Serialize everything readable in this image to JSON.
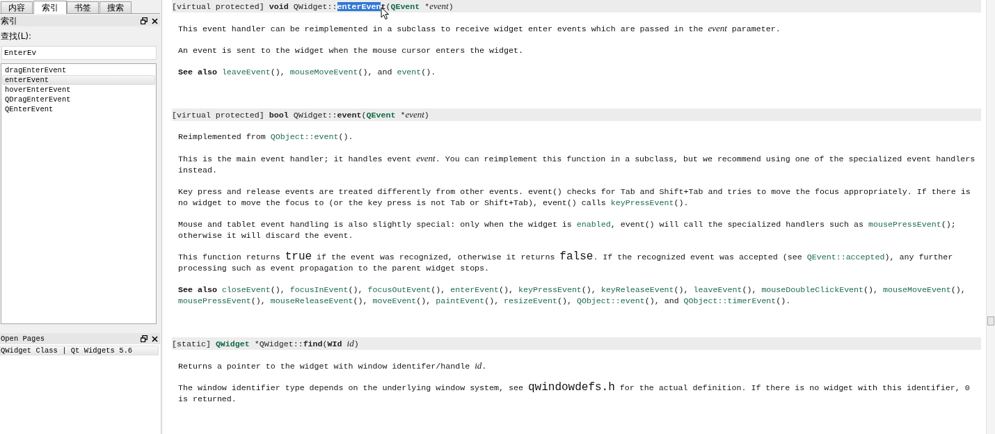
{
  "sidebar": {
    "tabs": [
      {
        "label": "内容",
        "selected": false
      },
      {
        "label": "索引",
        "selected": true
      },
      {
        "label": "书签",
        "selected": false
      },
      {
        "label": "搜索",
        "selected": false
      }
    ],
    "index_panel": {
      "title": "索引",
      "search_label": "查找(L):",
      "search_value": "EnterEv",
      "results": [
        {
          "label": "dragEnterEvent",
          "selected": false
        },
        {
          "label": "enterEvent",
          "selected": true
        },
        {
          "label": "hoverEnterEvent",
          "selected": false
        },
        {
          "label": "QDragEnterEvent",
          "selected": false
        },
        {
          "label": "QEnterEvent",
          "selected": false
        }
      ]
    },
    "open_pages": {
      "title": "Open Pages",
      "pages": [
        {
          "label": "QWidget Class | Qt Widgets 5.6",
          "selected": true
        }
      ]
    }
  },
  "document": {
    "sections": [
      {
        "signature": [
          {
            "kind": "plain",
            "text": "[virtual protected] "
          },
          {
            "kind": "bold",
            "text": "void"
          },
          {
            "kind": "plain",
            "text": " QWidget::"
          },
          {
            "kind": "selected",
            "text": "enterEven"
          },
          {
            "kind": "bold",
            "text": "t"
          },
          {
            "kind": "plain",
            "text": "("
          },
          {
            "kind": "type",
            "text": "QEvent"
          },
          {
            "kind": "plain",
            "text": " *"
          },
          {
            "kind": "italic",
            "text": "event"
          },
          {
            "kind": "plain",
            "text": ")"
          }
        ],
        "paragraphs": [
          [
            {
              "kind": "plain",
              "text": "This event handler can be reimplemented in a subclass to receive widget enter events which are passed in the "
            },
            {
              "kind": "italic",
              "text": "event"
            },
            {
              "kind": "plain",
              "text": " parameter."
            }
          ],
          [
            {
              "kind": "plain",
              "text": "An event is sent to the widget when the mouse cursor enters the widget."
            }
          ],
          [
            {
              "kind": "bold",
              "text": "See also "
            },
            {
              "kind": "link",
              "text": "leaveEvent"
            },
            {
              "kind": "plain",
              "text": "(), "
            },
            {
              "kind": "link",
              "text": "mouseMoveEvent"
            },
            {
              "kind": "plain",
              "text": "(), and "
            },
            {
              "kind": "link",
              "text": "event"
            },
            {
              "kind": "plain",
              "text": "()."
            }
          ]
        ]
      },
      {
        "signature": [
          {
            "kind": "plain",
            "text": "[virtual protected] "
          },
          {
            "kind": "bold",
            "text": "bool"
          },
          {
            "kind": "plain",
            "text": " QWidget::"
          },
          {
            "kind": "bold",
            "text": "event"
          },
          {
            "kind": "plain",
            "text": "("
          },
          {
            "kind": "type",
            "text": "QEvent"
          },
          {
            "kind": "plain",
            "text": " *"
          },
          {
            "kind": "italic",
            "text": "event"
          },
          {
            "kind": "plain",
            "text": ")"
          }
        ],
        "paragraphs": [
          [
            {
              "kind": "plain",
              "text": "Reimplemented from "
            },
            {
              "kind": "link",
              "text": "QObject::event"
            },
            {
              "kind": "plain",
              "text": "()."
            }
          ],
          [
            {
              "kind": "plain",
              "text": "This is the main event handler; it handles event "
            },
            {
              "kind": "italic",
              "text": "event"
            },
            {
              "kind": "plain",
              "text": ". You can reimplement this function in a subclass, but we recommend using one of the specialized event handlers instead."
            }
          ],
          [
            {
              "kind": "plain",
              "text": "Key press and release events are treated differently from other events. event() checks for Tab and Shift+Tab and tries to move the focus appropriately. If there is no widget to move the focus to (or the key press is not Tab or Shift+Tab), event() calls "
            },
            {
              "kind": "link",
              "text": "keyPressEvent"
            },
            {
              "kind": "plain",
              "text": "()."
            }
          ],
          [
            {
              "kind": "plain",
              "text": "Mouse and tablet event handling is also slightly special: only when the widget is "
            },
            {
              "kind": "link",
              "text": "enabled"
            },
            {
              "kind": "plain",
              "text": ", event() will call the specialized handlers such as "
            },
            {
              "kind": "link",
              "text": "mousePressEvent"
            },
            {
              "kind": "plain",
              "text": "(); otherwise it will discard the event."
            }
          ],
          [
            {
              "kind": "plain",
              "text": "This function returns "
            },
            {
              "kind": "code",
              "text": "true"
            },
            {
              "kind": "plain",
              "text": " if the event was recognized, otherwise it returns "
            },
            {
              "kind": "code",
              "text": "false"
            },
            {
              "kind": "plain",
              "text": ". If the recognized event was accepted (see "
            },
            {
              "kind": "link",
              "text": "QEvent::accepted"
            },
            {
              "kind": "plain",
              "text": "), any further processing such as event propagation to the parent widget stops."
            }
          ],
          [
            {
              "kind": "bold",
              "text": "See also "
            },
            {
              "kind": "link",
              "text": "closeEvent"
            },
            {
              "kind": "plain",
              "text": "(), "
            },
            {
              "kind": "link",
              "text": "focusInEvent"
            },
            {
              "kind": "plain",
              "text": "(), "
            },
            {
              "kind": "link",
              "text": "focusOutEvent"
            },
            {
              "kind": "plain",
              "text": "(), "
            },
            {
              "kind": "link",
              "text": "enterEvent"
            },
            {
              "kind": "plain",
              "text": "(), "
            },
            {
              "kind": "link",
              "text": "keyPressEvent"
            },
            {
              "kind": "plain",
              "text": "(), "
            },
            {
              "kind": "link",
              "text": "keyReleaseEvent"
            },
            {
              "kind": "plain",
              "text": "(), "
            },
            {
              "kind": "link",
              "text": "leaveEvent"
            },
            {
              "kind": "plain",
              "text": "(), "
            },
            {
              "kind": "link",
              "text": "mouseDoubleClickEvent"
            },
            {
              "kind": "plain",
              "text": "(), "
            },
            {
              "kind": "link",
              "text": "mouseMoveEvent"
            },
            {
              "kind": "plain",
              "text": "(), "
            },
            {
              "kind": "link",
              "text": "mousePressEvent"
            },
            {
              "kind": "plain",
              "text": "(), "
            },
            {
              "kind": "link",
              "text": "mouseReleaseEvent"
            },
            {
              "kind": "plain",
              "text": "(), "
            },
            {
              "kind": "link",
              "text": "moveEvent"
            },
            {
              "kind": "plain",
              "text": "(), "
            },
            {
              "kind": "link",
              "text": "paintEvent"
            },
            {
              "kind": "plain",
              "text": "(), "
            },
            {
              "kind": "link",
              "text": "resizeEvent"
            },
            {
              "kind": "plain",
              "text": "(), "
            },
            {
              "kind": "link",
              "text": "QObject::event"
            },
            {
              "kind": "plain",
              "text": "(), and "
            },
            {
              "kind": "link",
              "text": "QObject::timerEvent"
            },
            {
              "kind": "plain",
              "text": "()."
            }
          ]
        ]
      },
      {
        "signature": [
          {
            "kind": "plain",
            "text": "[static] "
          },
          {
            "kind": "type",
            "text": "QWidget"
          },
          {
            "kind": "plain",
            "text": " *QWidget::"
          },
          {
            "kind": "bold",
            "text": "find"
          },
          {
            "kind": "plain",
            "text": "("
          },
          {
            "kind": "bold",
            "text": "WId "
          },
          {
            "kind": "italic",
            "text": "id"
          },
          {
            "kind": "plain",
            "text": ")"
          }
        ],
        "paragraphs": [
          [
            {
              "kind": "plain",
              "text": "Returns a pointer to the widget with window identifer/handle "
            },
            {
              "kind": "italic",
              "text": "id"
            },
            {
              "kind": "plain",
              "text": "."
            }
          ],
          [
            {
              "kind": "plain",
              "text": "The window identifier type depends on the underlying window system, see "
            },
            {
              "kind": "code",
              "text": "qwindowdefs.h"
            },
            {
              "kind": "plain",
              "text": " for the actual definition. If there is no widget with this identifier, 0 is returned."
            }
          ]
        ]
      }
    ]
  }
}
